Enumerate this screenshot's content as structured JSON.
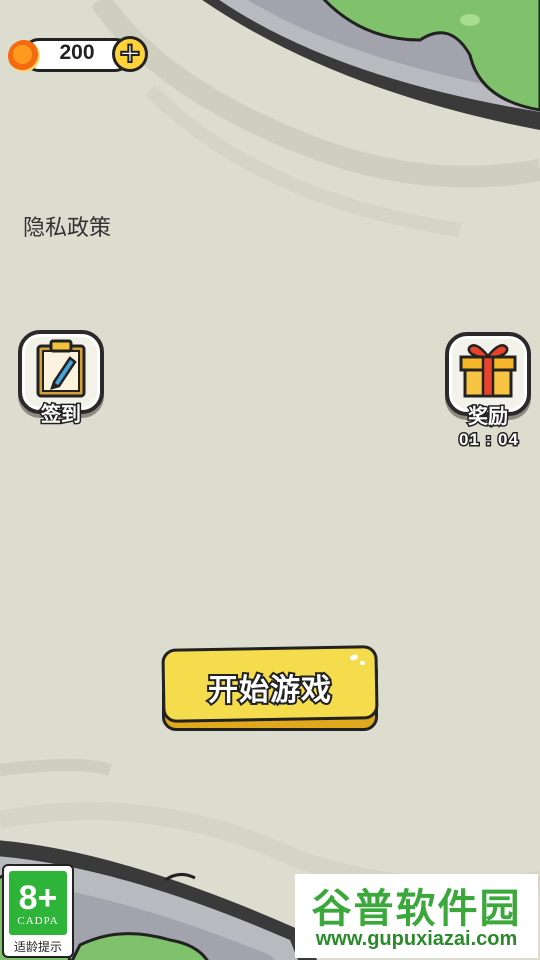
{
  "coins": {
    "value": "200",
    "icon": "coin-icon",
    "add_icon": "plus-icon"
  },
  "privacy": {
    "label": "隐私政策"
  },
  "checkin": {
    "label": "签到",
    "icon": "clipboard-pencil-icon"
  },
  "reward": {
    "label": "奖励",
    "timer": "01 : 04",
    "icon": "gift-box-icon"
  },
  "start": {
    "label": "开始游戏"
  },
  "age_rating": {
    "age": "8+",
    "org": "CADPA",
    "hint": "适龄提示"
  },
  "watermark": {
    "title": "谷普软件园",
    "url": "www.gupuxiazai.com"
  },
  "colors": {
    "background": "#dcdccf",
    "button_yellow": "#f4dc4d",
    "coin_orange": "#f46a10",
    "badge_green": "#2fb43a"
  }
}
